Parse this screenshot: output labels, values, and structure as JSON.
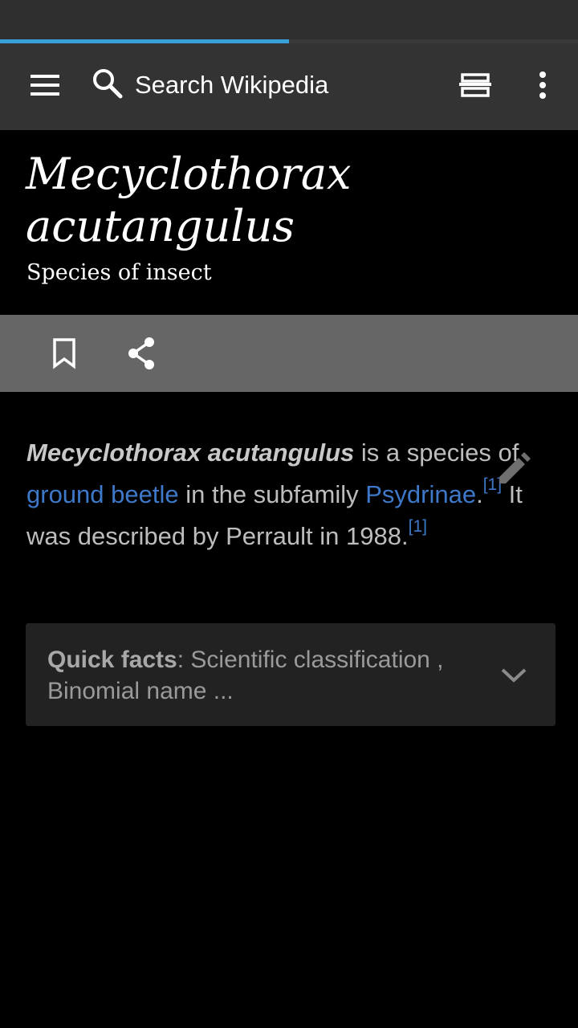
{
  "toolbar": {
    "search_placeholder": "Search Wikipedia",
    "menu_icon": "hamburger-menu-icon",
    "search_icon": "search-icon",
    "reading_list_icon": "reading-lists-icon",
    "overflow_icon": "more-vertical-icon"
  },
  "progress": {
    "fraction": 0.5
  },
  "article": {
    "title": "Mecyclothorax acutangulus",
    "subtitle": "Species of insect",
    "lead": {
      "bold_name": "Mecyclothorax acutangulus",
      "text1": " is a species of ",
      "link1": "ground beetle",
      "text2": " in the subfamily ",
      "link2": "Psydrinae",
      "text3": ".",
      "ref1": "[1]",
      "text4": " It was described by Perrault in 1988.",
      "ref2": "[1]"
    }
  },
  "actions": {
    "bookmark_icon": "bookmark-icon",
    "share_icon": "share-icon",
    "edit_icon": "pencil-icon"
  },
  "quick_facts": {
    "label": "Quick facts",
    "summary": ": Scientific classification , Binomial name ...",
    "expand_icon": "chevron-down-icon"
  },
  "colors": {
    "toolbar": "#333333",
    "action_bar": "#666666",
    "link": "#3e78c8",
    "progress": "#3aa0d8"
  }
}
